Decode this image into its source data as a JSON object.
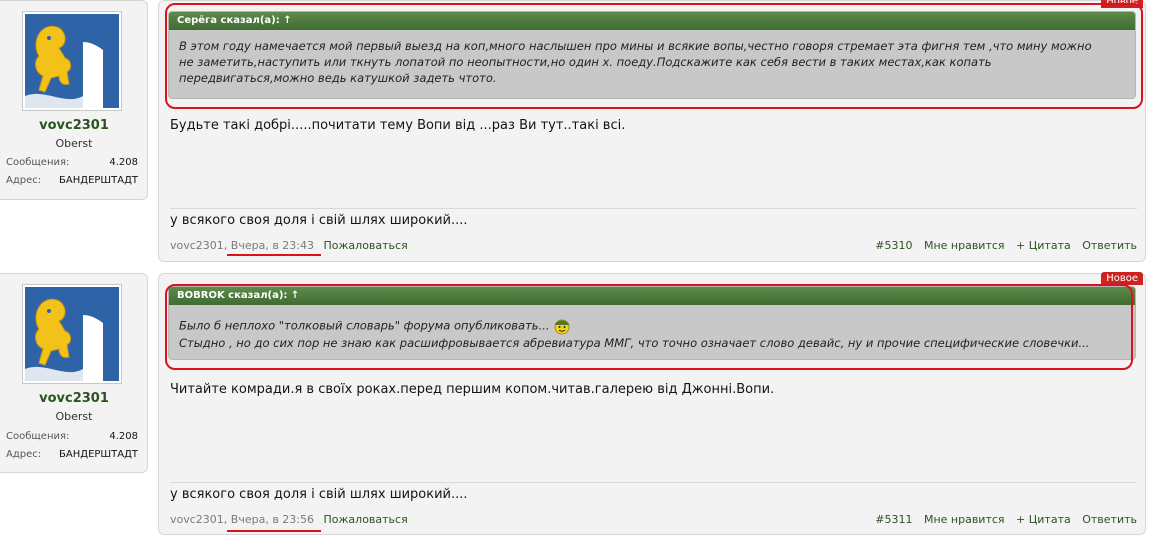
{
  "badge_new": "Новое",
  "colors": {
    "accent": "#2b5320",
    "quote_header": "#4a7a3a",
    "highlight": "#d7141c"
  },
  "posts": [
    {
      "user": {
        "name": "vovc2301",
        "title": "Oberst",
        "stats": [
          {
            "label": "Сообщения:",
            "value": "4.208"
          },
          {
            "label": "Адрес:",
            "value": "БАНДЕРШТАДТ"
          }
        ]
      },
      "quote": {
        "header": "Серёга сказал(а): ↑",
        "lines": [
          "В этом году намечается мой первый выезд на коп,много наслышен про мины и всякие вопы,честно говоря стремает эта фигня тем ,что мину можно",
          "не заметить,наступить или ткнуть лопатой по неопытности,но один х. поеду.Подскажите как себя вести в таких местах,как копать",
          "передвигаться,можно ведь катушкой задеть чтото."
        ]
      },
      "text": "Будьте такі добрі.....почитати тему Вопи від ...раз Ви тут..такі всі.",
      "signature": "у всякого своя доля і свій шлях широкий....",
      "footer": {
        "author": "vovc2301,",
        "date": "Вчера, в 23:43",
        "report": "Пожаловаться",
        "number": "#5310",
        "like": "Мне нравится",
        "quote": "+ Цитата",
        "reply": "Ответить"
      }
    },
    {
      "user": {
        "name": "vovc2301",
        "title": "Oberst",
        "stats": [
          {
            "label": "Сообщения:",
            "value": "4.208"
          },
          {
            "label": "Адрес:",
            "value": "БАНДЕРШТАДТ"
          }
        ]
      },
      "quote": {
        "header": "BOBROK сказал(а): ↑",
        "lines": [
          "Было б неплохо \"толковый словарь\" форума опубликовать...",
          "Стыдно , но до сих пор не знаю как расшифровывается абревиатура ММГ, что точно означает слово девайс, ну и прочие специфические словечки..."
        ]
      },
      "text": "Читайте комради.я в своїх роках.перед першим копом.читав.галерею від Джонні.Вопи.",
      "signature": "у всякого своя доля і свій шлях широкий....",
      "footer": {
        "author": "vovc2301,",
        "date": "Вчера, в 23:56",
        "report": "Пожаловаться",
        "number": "#5311",
        "like": "Мне нравится",
        "quote": "+ Цитата",
        "reply": "Ответить"
      }
    }
  ]
}
